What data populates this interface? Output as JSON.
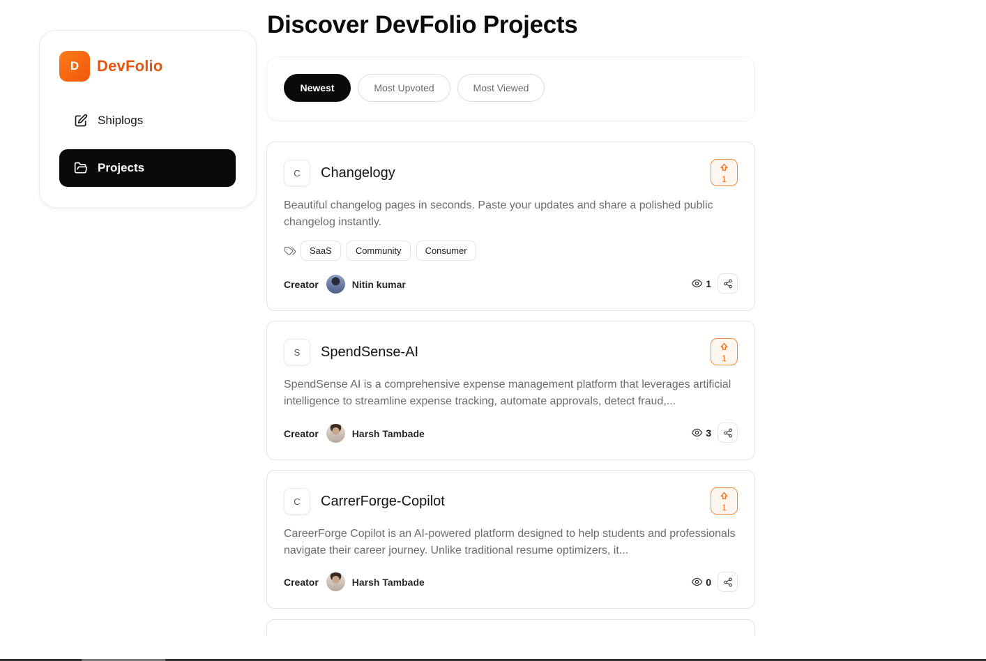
{
  "brand": {
    "logo_letter": "D",
    "name": "DevFolio",
    "accent": "#e8540c"
  },
  "nav": {
    "items": [
      {
        "label": "Shiplogs",
        "icon": "edit-icon",
        "active": false
      },
      {
        "label": "Projects",
        "icon": "folder-open-icon",
        "active": true
      }
    ]
  },
  "page": {
    "title": "Discover DevFolio Projects"
  },
  "filters": {
    "options": [
      "Newest",
      "Most Upvoted",
      "Most Viewed"
    ],
    "selected": "Newest"
  },
  "projects": [
    {
      "initial": "C",
      "name": "Changelogy",
      "upvotes": "1",
      "description": "Beautiful changelog pages in seconds. Paste your updates and share a polished public changelog instantly.",
      "tags": [
        "SaaS",
        "Community",
        "Consumer"
      ],
      "creator_label": "Creator",
      "creator": "Nitin kumar",
      "views": "1"
    },
    {
      "initial": "S",
      "name": "SpendSense-AI",
      "upvotes": "1",
      "description": "SpendSense AI is a comprehensive expense management platform that leverages artificial intelligence to streamline expense tracking, automate approvals, detect fraud,...",
      "tags": [],
      "creator_label": "Creator",
      "creator": "Harsh Tambade",
      "views": "3"
    },
    {
      "initial": "C",
      "name": "CarrerForge-Copilot",
      "upvotes": "1",
      "description": "CareerForge Copilot is an AI-powered platform designed to help students and professionals navigate their career journey. Unlike traditional resume optimizers, it...",
      "tags": [],
      "creator_label": "Creator",
      "creator": "Harsh Tambade",
      "views": "0"
    }
  ]
}
